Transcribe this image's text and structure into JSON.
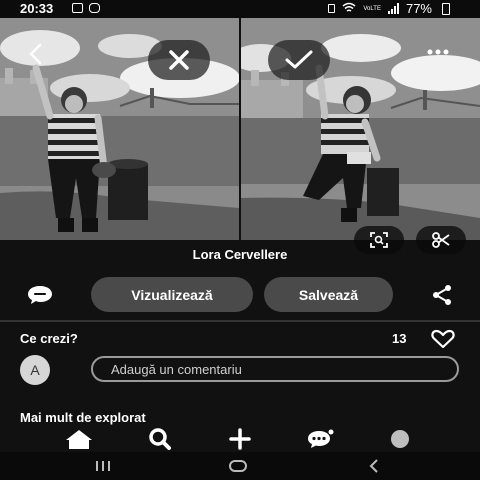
{
  "status_bar": {
    "time": "20:33",
    "battery": "77%",
    "network": "VoLTE"
  },
  "photos": {
    "left": {
      "alt_icon": "close-icon"
    },
    "right": {
      "alt_icon": "check-icon"
    }
  },
  "pin": {
    "author": "Lora Cervellere",
    "view_button": "Vizualizează",
    "save_button": "Salvează"
  },
  "comments": {
    "question": "Ce crezi?",
    "reactions_count": "13",
    "avatar_initial": "A",
    "input_placeholder": "Adaugă un comentariu"
  },
  "more_section": {
    "title": "Mai mult de explorat"
  },
  "bottom_nav": {
    "items": [
      "home-icon",
      "search-icon",
      "create-icon",
      "messages-icon",
      "profile-icon"
    ]
  },
  "colors": {
    "background": "#111111",
    "button": "#4a4a4a",
    "text": "#ffffff"
  }
}
